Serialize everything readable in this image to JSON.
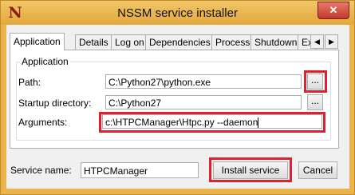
{
  "window": {
    "title": "NSSM service installer",
    "close_glyph": "✕"
  },
  "tabs": [
    "Application",
    "Details",
    "Log on",
    "Dependencies",
    "Process",
    "Shutdown",
    "Exit"
  ],
  "tab_scroll": {
    "left": "◀",
    "right": "▶"
  },
  "application_group": {
    "legend": "Application",
    "path_label": "Path:",
    "path_value": "C:\\Python27\\python.exe",
    "startup_label": "Startup directory:",
    "startup_value": "C:\\Python27",
    "arguments_label": "Arguments:",
    "arguments_value": "c:\\HTPCManager\\Htpc.py --daemon",
    "browse_label": "..."
  },
  "service_name": {
    "label": "Service name:",
    "value": "HTPCManager"
  },
  "buttons": {
    "install": "Install service",
    "cancel": "Cancel"
  },
  "colors": {
    "highlight": "#e0202f",
    "title_bar": "#eab44a"
  }
}
